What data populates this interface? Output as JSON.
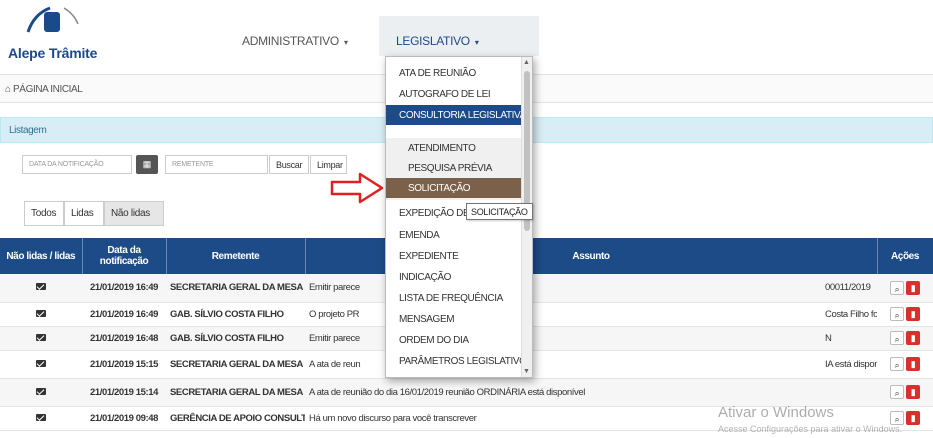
{
  "app": {
    "logo_text": "Alepe Trâmite"
  },
  "nav": {
    "administrativo_label": "ADMINISTRATIVO",
    "legislativo_label": "LEGISLATIVO"
  },
  "breadcrumb": {
    "home_label": "PÁGINA INICIAL",
    "icon": "home-icon"
  },
  "panel": {
    "title": "Listagem"
  },
  "filters": {
    "date_placeholder": "DATA DA NOTIFICAÇÃO",
    "remetente_placeholder": "REMETENTE",
    "buscar_label": "Buscar",
    "limpar_label": "Limpar"
  },
  "tabs": [
    {
      "label": "Todos"
    },
    {
      "label": "Lidas"
    },
    {
      "label": "Não lidas",
      "selected": true
    }
  ],
  "table": {
    "headers": [
      "Não lidas / lidas",
      "Data da notificação",
      "Remetente",
      "Assunto",
      "Ações"
    ],
    "rows": [
      {
        "date": "21/01/2019 16:49",
        "remetente": "SECRETARIA GERAL DA MESA DIRETORA (SEGMD)",
        "assunto": "Emitir parece",
        "assunto_tail": "00011/2019"
      },
      {
        "date": "21/01/2019 16:49",
        "remetente": "GAB. SÍLVIO COSTA FILHO",
        "assunto": "O projeto PR",
        "assunto_tail": "Costa Filho foi enviado para a Secretaria Geral da Mesa Diretora"
      },
      {
        "date": "21/01/2019 16:48",
        "remetente": "GAB. SÍLVIO COSTA FILHO",
        "assunto": "Emitir parece",
        "assunto_tail": "N"
      },
      {
        "date": "21/01/2019 15:15",
        "remetente": "SECRETARIA GERAL DA MESA DIRETORA (SEGMD)",
        "assunto": "A ata de reun",
        "assunto_tail": "IA está disponível"
      },
      {
        "date": "21/01/2019 15:14",
        "remetente": "SECRETARIA GERAL DA MESA DIRETORA (SEGMD)",
        "assunto": "A ata de reunião do dia 16/01/2019 reunião ORDINÁRIA está disponível",
        "assunto_tail": ""
      },
      {
        "date": "21/01/2019 09:48",
        "remetente": "GERÊNCIA DE APOIO CONSULTIVO",
        "assunto": "Há um novo discurso para você transcrever",
        "assunto_tail": ""
      }
    ]
  },
  "dropdown": {
    "items": [
      "ATA DE REUNIÃO",
      "AUTOGRAFO DE LEI",
      "CONSULTORIA LEGISLATIVA"
    ],
    "subitems": [
      "ATENDIMENTO",
      "PESQUISA PRÉVIA",
      "SOLICITAÇÃO"
    ],
    "items_after": [
      "EXPEDIÇÃO DE C",
      "EMENDA",
      "EXPEDIENTE",
      "INDICAÇÃO",
      "LISTA DE FREQUÊNCIA",
      "MENSAGEM",
      "ORDEM DO DIA",
      "PARÂMETROS LEGISLATIVOS"
    ]
  },
  "tooltip": {
    "text": "SOLICITAÇÃO"
  },
  "watermark": {
    "title": "Ativar o Windows",
    "subtitle": "Acesse Configurações para ativar o Windows."
  },
  "colors": {
    "brand": "#1b4a8a",
    "table_header": "#1c4b87",
    "highlight_brown": "#7b6149",
    "arrow_red": "#e02020",
    "danger": "#d9302c",
    "panel_bg": "#d9edf7"
  }
}
